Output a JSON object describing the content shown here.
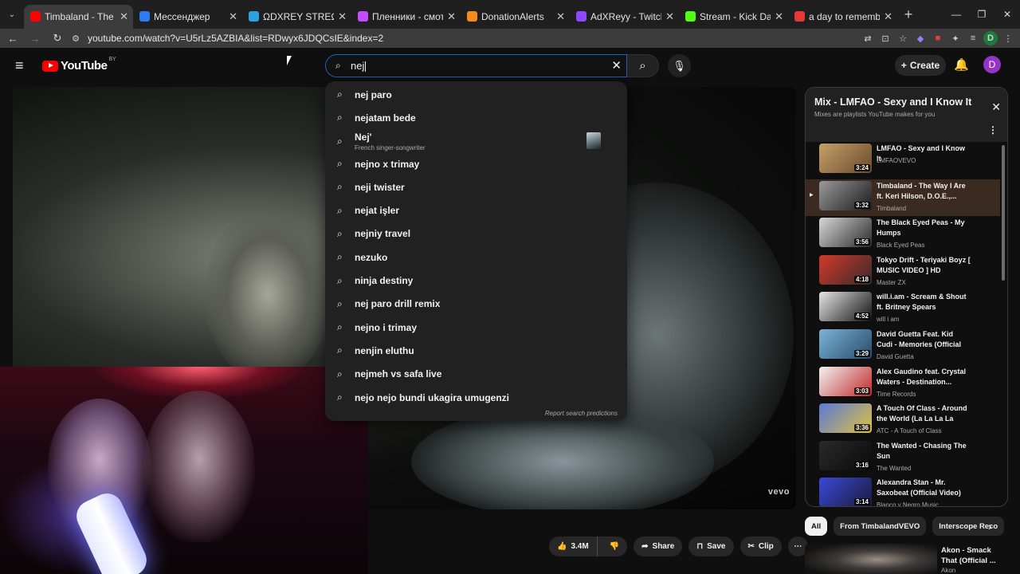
{
  "browser": {
    "tabs": [
      {
        "title": "Timbaland - The Way I Are",
        "color": "#ff0000",
        "active": true
      },
      {
        "title": "Мессенджер",
        "color": "#2d7cf6",
        "active": false
      },
      {
        "title": "ΩDXREY STREΩM CHΩT",
        "color": "#2aa3e0",
        "active": false
      },
      {
        "title": "Пленники - смотреть вид",
        "color": "#c54bff",
        "active": false
      },
      {
        "title": "DonationAlerts",
        "color": "#f58b1f",
        "active": false
      },
      {
        "title": "AdXReyy - Twitch",
        "color": "#9146ff",
        "active": false
      },
      {
        "title": "Stream - Kick Dashboard",
        "color": "#53fc18",
        "active": false
      },
      {
        "title": "a day to remember end o",
        "color": "#e53935",
        "active": false
      }
    ],
    "url": "youtube.com/watch?v=U5rLz5AZBIA&list=RDwyx6JDQCsIE&index=2",
    "profile_initial": "D"
  },
  "header": {
    "logo_text": "YouTube",
    "logo_country": "BY",
    "search_value": "nej",
    "create_label": "Create",
    "avatar_initial": "D"
  },
  "suggestions": [
    {
      "text": "nej paro"
    },
    {
      "text": "nejatam bede"
    },
    {
      "text": "Nej'",
      "subtitle": "French singer-songwriter",
      "has_thumb": true
    },
    {
      "text": "nejno x trimay"
    },
    {
      "text": "neji twister"
    },
    {
      "text": "nejat işler"
    },
    {
      "text": "nejniy travel"
    },
    {
      "text": "nezuko"
    },
    {
      "text": "ninja destiny"
    },
    {
      "text": "nej paro drill remix"
    },
    {
      "text": "nejno i trimay"
    },
    {
      "text": "nenjin eluthu"
    },
    {
      "text": "nejmeh vs safa live"
    },
    {
      "text": "nejo nejo bundi ukagira umugenzi"
    }
  ],
  "report_label": "Report search predictions",
  "video": {
    "watermark": "vevo"
  },
  "playlist": {
    "title": "Mix - LMFAO - Sexy and I Know It",
    "subtitle": "Mixes are playlists YouTube makes for you",
    "items": [
      {
        "title": "LMFAO - Sexy and I Know It",
        "channel": "LMFAOVEVO",
        "duration": "3:24",
        "active": false,
        "colors": [
          "#c4a068",
          "#6b4a2e"
        ]
      },
      {
        "title": "Timbaland - The Way I Are ft. Keri Hilson, D.O.E.,...",
        "channel": "Timbaland",
        "duration": "3:32",
        "active": true,
        "colors": [
          "#9a9a9a",
          "#1a1a1a"
        ]
      },
      {
        "title": "The Black Eyed Peas - My Humps",
        "channel": "Black Eyed Peas",
        "duration": "3:56",
        "active": false,
        "colors": [
          "#d8d8d8",
          "#2a2a2a"
        ]
      },
      {
        "title": "Tokyo Drift - Teriyaki Boyz [ MUSIC VIDEO ] HD",
        "channel": "Master ZX",
        "duration": "4:18",
        "active": false,
        "colors": [
          "#d03a2a",
          "#3a2a2a"
        ]
      },
      {
        "title": "will.i.am - Scream & Shout ft. Britney Spears",
        "channel": "will i am",
        "duration": "4:52",
        "active": false,
        "colors": [
          "#e6e6e6",
          "#111111"
        ]
      },
      {
        "title": "David Guetta Feat. Kid Cudi - Memories (Official Video)",
        "channel": "David Guetta",
        "duration": "3:29",
        "active": false,
        "colors": [
          "#7ab4d8",
          "#2a4a6a"
        ]
      },
      {
        "title": "Alex Gaudino feat. Crystal Waters - Destination...",
        "channel": "Time Records",
        "duration": "3:03",
        "active": false,
        "colors": [
          "#f2f2f2",
          "#c02a2a"
        ]
      },
      {
        "title": "A Touch Of Class - Around the World (La La La La La)...",
        "channel": "ATC - A Touch of Class",
        "duration": "3:36",
        "active": false,
        "colors": [
          "#5a7ad8",
          "#e0c040"
        ]
      },
      {
        "title": "The Wanted - Chasing The Sun",
        "channel": "The Wanted",
        "duration": "3:16",
        "active": false,
        "colors": [
          "#2a2a2a",
          "#0a0a0a"
        ]
      },
      {
        "title": "Alexandra Stan - Mr. Saxobeat (Official Video)",
        "channel": "Blanco y Negro Music",
        "duration": "3:14",
        "active": false,
        "colors": [
          "#3a4ad8",
          "#1a1a3a"
        ]
      }
    ]
  },
  "chips": [
    {
      "label": "All",
      "selected": true
    },
    {
      "label": "From TimbalandVEVO",
      "selected": false
    },
    {
      "label": "Interscope Reco",
      "selected": false
    }
  ],
  "actions": {
    "likes": "3.4M",
    "share": "Share",
    "save": "Save",
    "clip": "Clip"
  },
  "next_video": {
    "title": "Akon - Smack That (Official ...",
    "channel": "Akon"
  }
}
